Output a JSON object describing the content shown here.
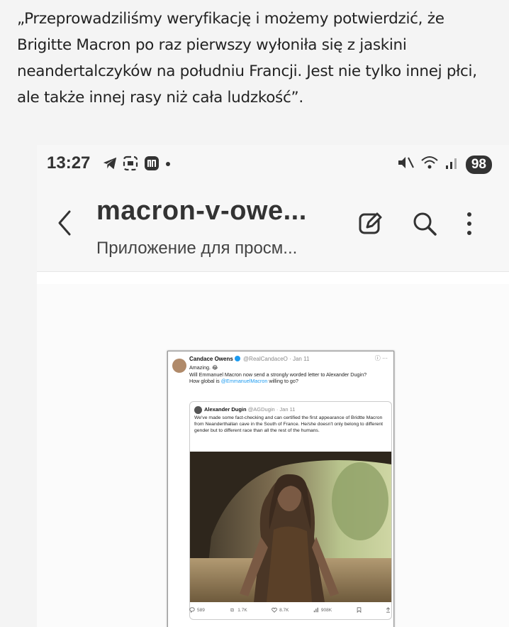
{
  "article": {
    "quote": "„Przeprowadziliśmy weryfikację i możemy potwierdzić, że Brigitte Macron po raz pierwszy wyłoniła się z jaskini neandertalczyków na południu Francji. Jest nie tylko innej płci, ale także innej rasy niż cała ludzkość”."
  },
  "statusbar": {
    "time": "13:27",
    "battery": "98",
    "icons": [
      "telegram-icon",
      "screenshot-icon",
      "app-icon",
      "dot-icon",
      "mute-icon",
      "wifi-icon",
      "signal-icon"
    ]
  },
  "appbar": {
    "title": "macron-v-owe...",
    "subtitle": "Приложение для просм...",
    "icons": [
      "back-arrow-icon",
      "edit-icon",
      "search-icon",
      "more-icon"
    ]
  },
  "tweet": {
    "author": "Candace Owens",
    "handle": "@RealCandaceO · Jan 11",
    "line1": "Amazing. 😂",
    "line2": "Will Emmanuel Macron now send a strongly worded letter to Alexander Dugin?",
    "line3_prefix": "How global is ",
    "line3_mention": "@EmmanuelMacron",
    "line3_suffix": " willing to go?",
    "quoted": {
      "author": "Alexander Dugin",
      "handle": "@AGDugin · Jan 11",
      "text": "We've made some fact-checking and can certified the first appearance of Bridtte Macron from Neanderthallan cave in the South of France. He/she doesn't only belong to different gender but to different race than all the rest of the humans."
    },
    "stats": {
      "replies": "589",
      "retweets": "1.7K",
      "likes": "8.7K",
      "views": "908K"
    }
  },
  "colors": {
    "accent": "#1d9bf0",
    "text": "#222222",
    "background": "#f4f4f4"
  }
}
